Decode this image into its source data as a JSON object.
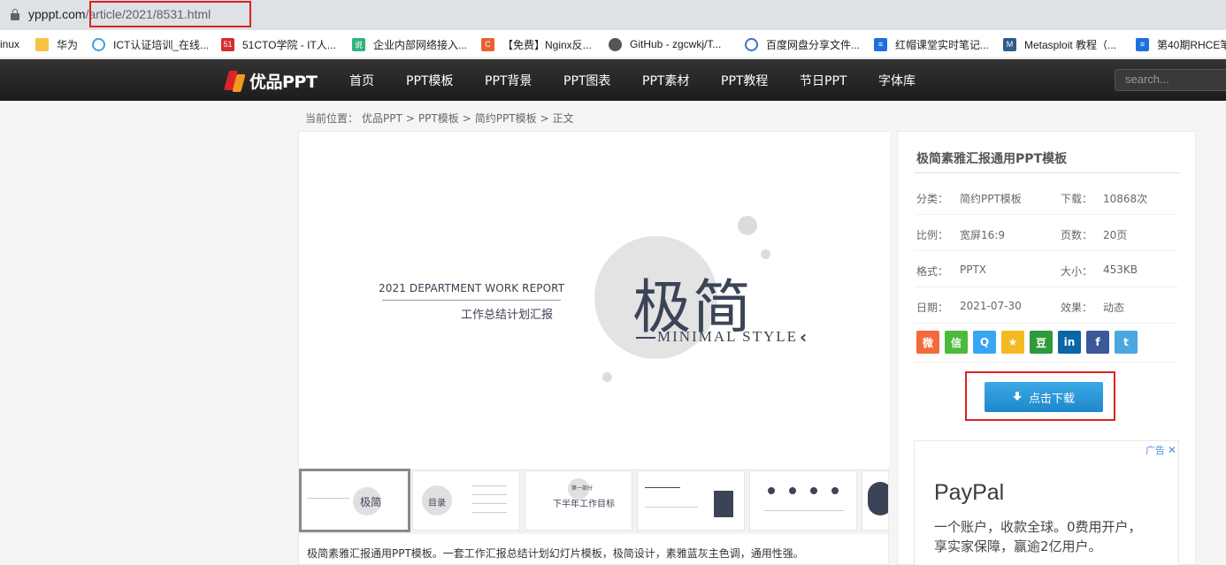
{
  "browser": {
    "url_host": "ypppt.com",
    "url_path": "/article/2021/8531.html"
  },
  "bookmarks": [
    {
      "label": "inux",
      "icon": "none"
    },
    {
      "label": "华为",
      "icon": "folder-icon"
    },
    {
      "label": "ICT认证培训_在线...",
      "icon": "ict-icon"
    },
    {
      "label": "51CTO学院 - IT人...",
      "icon": "51cto-icon"
    },
    {
      "label": "企业内部网络接入...",
      "icon": "doc-icon"
    },
    {
      "label": "【免费】Nginx反...",
      "icon": "csdn-icon"
    },
    {
      "label": "GitHub - zgcwkj/T...",
      "icon": "github-icon"
    },
    {
      "label": "百度网盘分享文件...",
      "icon": "baidu-icon"
    },
    {
      "label": "红帽课堂实时笔记...",
      "icon": "note-icon"
    },
    {
      "label": "Metasploit 教程（...",
      "icon": "metasploit-icon"
    },
    {
      "label": "第40期RHCE笔",
      "icon": "note-icon"
    }
  ],
  "site": {
    "logo_text": "优品PPT",
    "nav": [
      "首页",
      "PPT模板",
      "PPT背景",
      "PPT图表",
      "PPT素材",
      "PPT教程",
      "节日PPT",
      "字体库"
    ],
    "search_placeholder": "search..."
  },
  "breadcrumb": [
    "当前位置：",
    "优品PPT",
    ">",
    "PPT模板",
    ">",
    "简约PPT模板",
    ">",
    "正文"
  ],
  "slide": {
    "en_title": "2021 DEPARTMENT WORK REPORT",
    "cn_title": "工作总结计划汇报",
    "big_text": "极简",
    "style_text": "MINIMAL STYLE",
    "chevron": "‹"
  },
  "thumbs": {
    "t1": "极简",
    "t2": "目录",
    "t3": "下半年工作目标",
    "t3_sub": "第一部分"
  },
  "description": "极简素雅汇报通用PPT模板。一套工作汇报总结计划幻灯片模板，极简设计，素雅蓝灰主色调，通用性强。",
  "sidebar": {
    "title": "极简素雅汇报通用PPT模板",
    "rows": [
      {
        "k1": "分类：",
        "v1": "简约PPT模板",
        "k2": "下载：",
        "v2": "10868次"
      },
      {
        "k1": "比例：",
        "v1": "宽屏16:9",
        "k2": "页数：",
        "v2": "20页"
      },
      {
        "k1": "格式：",
        "v1": "PPTX",
        "k2": "大小：",
        "v2": "453KB"
      },
      {
        "k1": "日期：",
        "v1": "2021-07-30",
        "k2": "效果：",
        "v2": "动态"
      }
    ],
    "share": [
      {
        "name": "weibo",
        "glyph": "微",
        "color": "#f56a3b"
      },
      {
        "name": "wechat",
        "glyph": "信",
        "color": "#4cba3c"
      },
      {
        "name": "qq",
        "glyph": "Q",
        "color": "#38a6f3"
      },
      {
        "name": "qzone",
        "glyph": "★",
        "color": "#f4b920"
      },
      {
        "name": "douban",
        "glyph": "豆",
        "color": "#2f9a3a"
      },
      {
        "name": "linkedin",
        "glyph": "in",
        "color": "#0a66a4"
      },
      {
        "name": "facebook",
        "glyph": "f",
        "color": "#3b5998"
      },
      {
        "name": "twitter",
        "glyph": "t",
        "color": "#4aa7e0"
      }
    ],
    "download_label": "点击下载"
  },
  "ad": {
    "tag": "广告",
    "close": "✕",
    "brand": "PayPal",
    "line1": "一个账户，收款全球。0费用开户，",
    "line2": "享实家保障，赢逾2亿用户。"
  }
}
